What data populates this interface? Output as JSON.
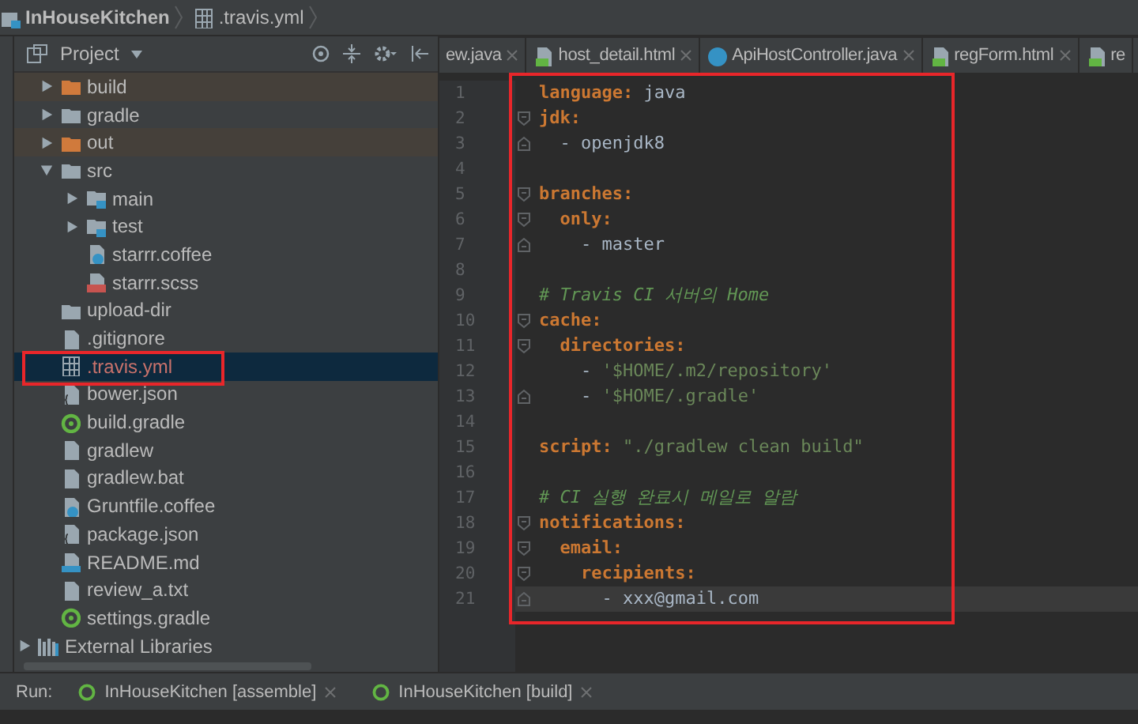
{
  "breadcrumb": [
    {
      "label": "InHouseKitchen",
      "kind": "module"
    },
    {
      "label": ".travis.yml",
      "kind": "yml"
    }
  ],
  "project_panel": {
    "title": "Project",
    "tree": [
      {
        "label": "build",
        "kind": "excluded-folder",
        "expanded": false,
        "selected": false,
        "color": "#bbbbbb"
      },
      {
        "label": "gradle",
        "kind": "folder",
        "expanded": false,
        "selected": false,
        "color": "#bbbbbb"
      },
      {
        "label": "out",
        "kind": "excluded-folder",
        "expanded": false,
        "selected": false,
        "color": "#bbbbbb"
      },
      {
        "label": "src",
        "kind": "folder",
        "expanded": true,
        "selected": false,
        "color": "#bbbbbb",
        "children": [
          {
            "label": "main",
            "kind": "source-folder",
            "expanded": false,
            "selected": false,
            "color": "#bbbbbb"
          },
          {
            "label": "test",
            "kind": "source-folder",
            "expanded": false,
            "selected": false,
            "color": "#bbbbbb"
          },
          {
            "label": "starrr.coffee",
            "kind": "coffee",
            "selected": false,
            "color": "#bbbbbb"
          },
          {
            "label": "starrr.scss",
            "kind": "scss",
            "selected": false,
            "color": "#bbbbbb"
          }
        ]
      },
      {
        "label": "upload-dir",
        "kind": "folder",
        "selected": false,
        "color": "#bbbbbb"
      },
      {
        "label": ".gitignore",
        "kind": "file",
        "selected": false,
        "color": "#bbbbbb"
      },
      {
        "label": ".travis.yml",
        "kind": "yml",
        "selected": true,
        "color": "#c9726b"
      },
      {
        "label": "bower.json",
        "kind": "json",
        "selected": false,
        "color": "#bbbbbb"
      },
      {
        "label": "build.gradle",
        "kind": "gradle",
        "selected": false,
        "color": "#bbbbbb"
      },
      {
        "label": "gradlew",
        "kind": "file",
        "selected": false,
        "color": "#bbbbbb"
      },
      {
        "label": "gradlew.bat",
        "kind": "file",
        "selected": false,
        "color": "#bbbbbb"
      },
      {
        "label": "Gruntfile.coffee",
        "kind": "coffee",
        "selected": false,
        "color": "#bbbbbb"
      },
      {
        "label": "package.json",
        "kind": "json",
        "selected": false,
        "color": "#bbbbbb"
      },
      {
        "label": "README.md",
        "kind": "markdown",
        "selected": false,
        "color": "#bbbbbb"
      },
      {
        "label": "review_a.txt",
        "kind": "file",
        "selected": false,
        "color": "#bbbbbb"
      },
      {
        "label": "settings.gradle",
        "kind": "gradle",
        "selected": false,
        "color": "#bbbbbb"
      }
    ],
    "libraries": {
      "label": "External Libraries",
      "expanded": false
    }
  },
  "editor_tabs": [
    {
      "label": "ew.java",
      "kind": "plain",
      "selected": false
    },
    {
      "label": "host_detail.html",
      "kind": "html",
      "selected": false
    },
    {
      "label": "ApiHostController.java",
      "kind": "class",
      "selected": false
    },
    {
      "label": "regForm.html",
      "kind": "html",
      "selected": false
    },
    {
      "label": "re",
      "kind": "html",
      "selected": false
    }
  ],
  "editor": {
    "lines": [
      {
        "number": "1",
        "kind": "plain",
        "current": false,
        "tokens": [
          {
            "kind": "key",
            "text": "language"
          },
          {
            "kind": "punct",
            "text": ": "
          },
          {
            "kind": "plain",
            "text": "java"
          }
        ]
      },
      {
        "number": "2",
        "kind": "fold-start",
        "current": false,
        "tokens": [
          {
            "kind": "key",
            "text": "jdk"
          },
          {
            "kind": "punct",
            "text": ":"
          }
        ]
      },
      {
        "number": "3",
        "kind": "fold-end",
        "current": false,
        "tokens": [
          {
            "kind": "plain",
            "text": "  - openjdk8"
          }
        ]
      },
      {
        "number": "4",
        "kind": "plain",
        "current": false
      },
      {
        "number": "5",
        "kind": "fold-start",
        "current": false,
        "tokens": [
          {
            "kind": "key",
            "text": "branches"
          },
          {
            "kind": "punct",
            "text": ":"
          }
        ]
      },
      {
        "number": "6",
        "kind": "fold-start",
        "current": false,
        "tokens": [
          {
            "kind": "key",
            "text": "  only"
          },
          {
            "kind": "punct",
            "text": ":"
          }
        ]
      },
      {
        "number": "7",
        "kind": "fold-end",
        "current": false,
        "tokens": [
          {
            "kind": "plain",
            "text": "    - master"
          }
        ]
      },
      {
        "number": "8",
        "kind": "plain",
        "current": false
      },
      {
        "number": "9",
        "kind": "plain",
        "current": false,
        "tokens": [
          {
            "kind": "comment",
            "text": "# Travis CI 서버의 Home"
          }
        ]
      },
      {
        "number": "10",
        "kind": "fold-start",
        "current": false,
        "tokens": [
          {
            "kind": "key",
            "text": "cache"
          },
          {
            "kind": "punct",
            "text": ":"
          }
        ]
      },
      {
        "number": "11",
        "kind": "fold-start",
        "current": false,
        "tokens": [
          {
            "kind": "key",
            "text": "  directories"
          },
          {
            "kind": "punct",
            "text": ":"
          }
        ]
      },
      {
        "number": "12",
        "kind": "plain",
        "current": false,
        "tokens": [
          {
            "kind": "plain",
            "text": "    - "
          },
          {
            "kind": "string",
            "text": "'$HOME/.m2/repository'"
          }
        ]
      },
      {
        "number": "13",
        "kind": "fold-end",
        "current": false,
        "tokens": [
          {
            "kind": "plain",
            "text": "    - "
          },
          {
            "kind": "string",
            "text": "'$HOME/.gradle'"
          }
        ]
      },
      {
        "number": "14",
        "kind": "plain",
        "current": false
      },
      {
        "number": "15",
        "kind": "plain",
        "current": false,
        "tokens": [
          {
            "kind": "key",
            "text": "script"
          },
          {
            "kind": "punct",
            "text": ": "
          },
          {
            "kind": "string",
            "text": "\"./gradlew clean build\""
          }
        ]
      },
      {
        "number": "16",
        "kind": "plain",
        "current": false
      },
      {
        "number": "17",
        "kind": "plain",
        "current": false,
        "tokens": [
          {
            "kind": "comment",
            "text": "# CI 실행 완료시 메일로 알람"
          }
        ]
      },
      {
        "number": "18",
        "kind": "fold-start",
        "current": false,
        "tokens": [
          {
            "kind": "key",
            "text": "notifications"
          },
          {
            "kind": "punct",
            "text": ":"
          }
        ]
      },
      {
        "number": "19",
        "kind": "fold-start",
        "current": false,
        "tokens": [
          {
            "kind": "key",
            "text": "  email"
          },
          {
            "kind": "punct",
            "text": ":"
          }
        ]
      },
      {
        "number": "20",
        "kind": "fold-start",
        "current": false,
        "tokens": [
          {
            "kind": "key",
            "text": "    recipients"
          },
          {
            "kind": "punct",
            "text": ":"
          }
        ]
      },
      {
        "number": "21",
        "kind": "fold-end",
        "current": true,
        "tokens": [
          {
            "kind": "plain",
            "text": "      - xxx@gmail.com"
          }
        ]
      }
    ]
  },
  "run_bar": {
    "label": "Run:",
    "tabs": [
      {
        "label": "InHouseKitchen [assemble]",
        "selected": false
      },
      {
        "label": "InHouseKitchen [build]",
        "selected": false
      }
    ]
  }
}
